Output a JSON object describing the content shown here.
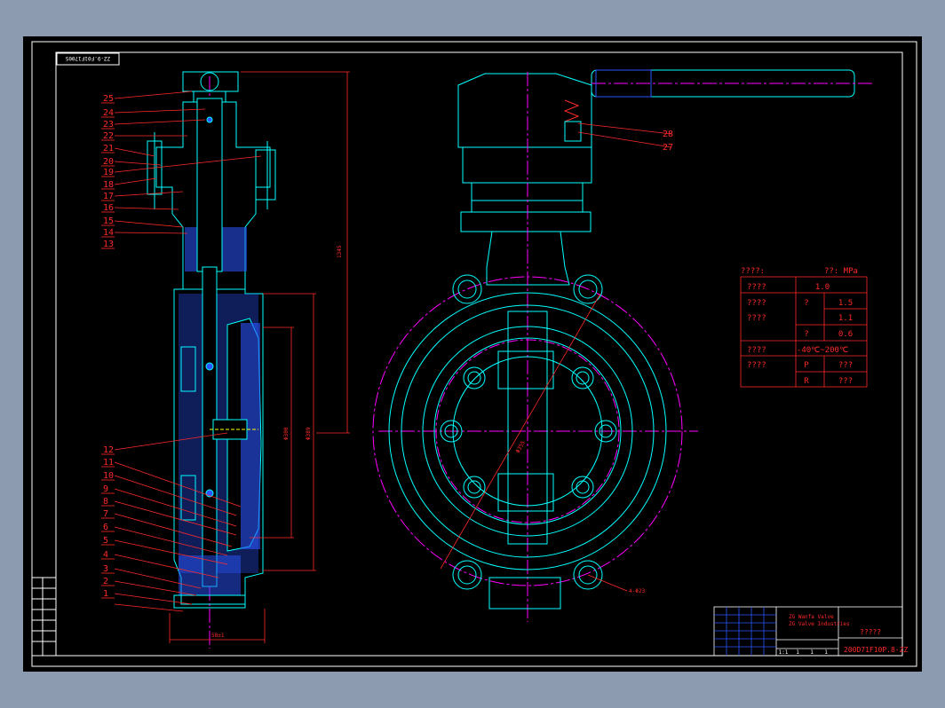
{
  "drawing": {
    "corner_code": "ZZ-9.F01F1700S",
    "part_numbers": [
      "25",
      "24",
      "23",
      "22",
      "21",
      "20",
      "19",
      "18",
      "17",
      "16",
      "15",
      "14",
      "13",
      "12",
      "11",
      "10",
      "9",
      "8",
      "7",
      "6",
      "5",
      "4",
      "3",
      "2",
      "1"
    ],
    "right_part_numbers": [
      "28",
      "27"
    ],
    "dimensions": {
      "height": "1345",
      "dia_inner": "Φ300",
      "dia_outer": "Φ389",
      "width": "58±1",
      "pcd": "Φ355",
      "holes": "4-Φ23"
    }
  },
  "spec_table": {
    "header_left": "????:",
    "header_right": "??: MPa",
    "rows": [
      {
        "label": "????",
        "sub": "",
        "value": "1.0"
      },
      {
        "label": "????",
        "sub": "?",
        "value": "1.5"
      },
      {
        "label": "????",
        "sub": "",
        "value": "1.1"
      },
      {
        "label": "",
        "sub": "?",
        "value": "0.6"
      },
      {
        "label": "????",
        "sub": "",
        "value": "-40℃~200℃"
      },
      {
        "label": "????",
        "sub": "P",
        "value": "???"
      },
      {
        "label": "",
        "sub": "R",
        "value": "???"
      }
    ]
  },
  "title_block": {
    "company_line1": "ZG Wanfa Valve",
    "company_line2": "ZG Valve Industries",
    "name": "?????",
    "drawing_no": "200D71F10P.8-ZZ",
    "small_cells": [
      "1:1",
      "1",
      "1",
      "1"
    ]
  },
  "colors": {
    "outline": "#00ffff",
    "center": "#ff00ff",
    "dim": "#ff2a2a",
    "frame": "#ffffff",
    "blue": "#2b55ff",
    "yellow": "#ffff00"
  }
}
